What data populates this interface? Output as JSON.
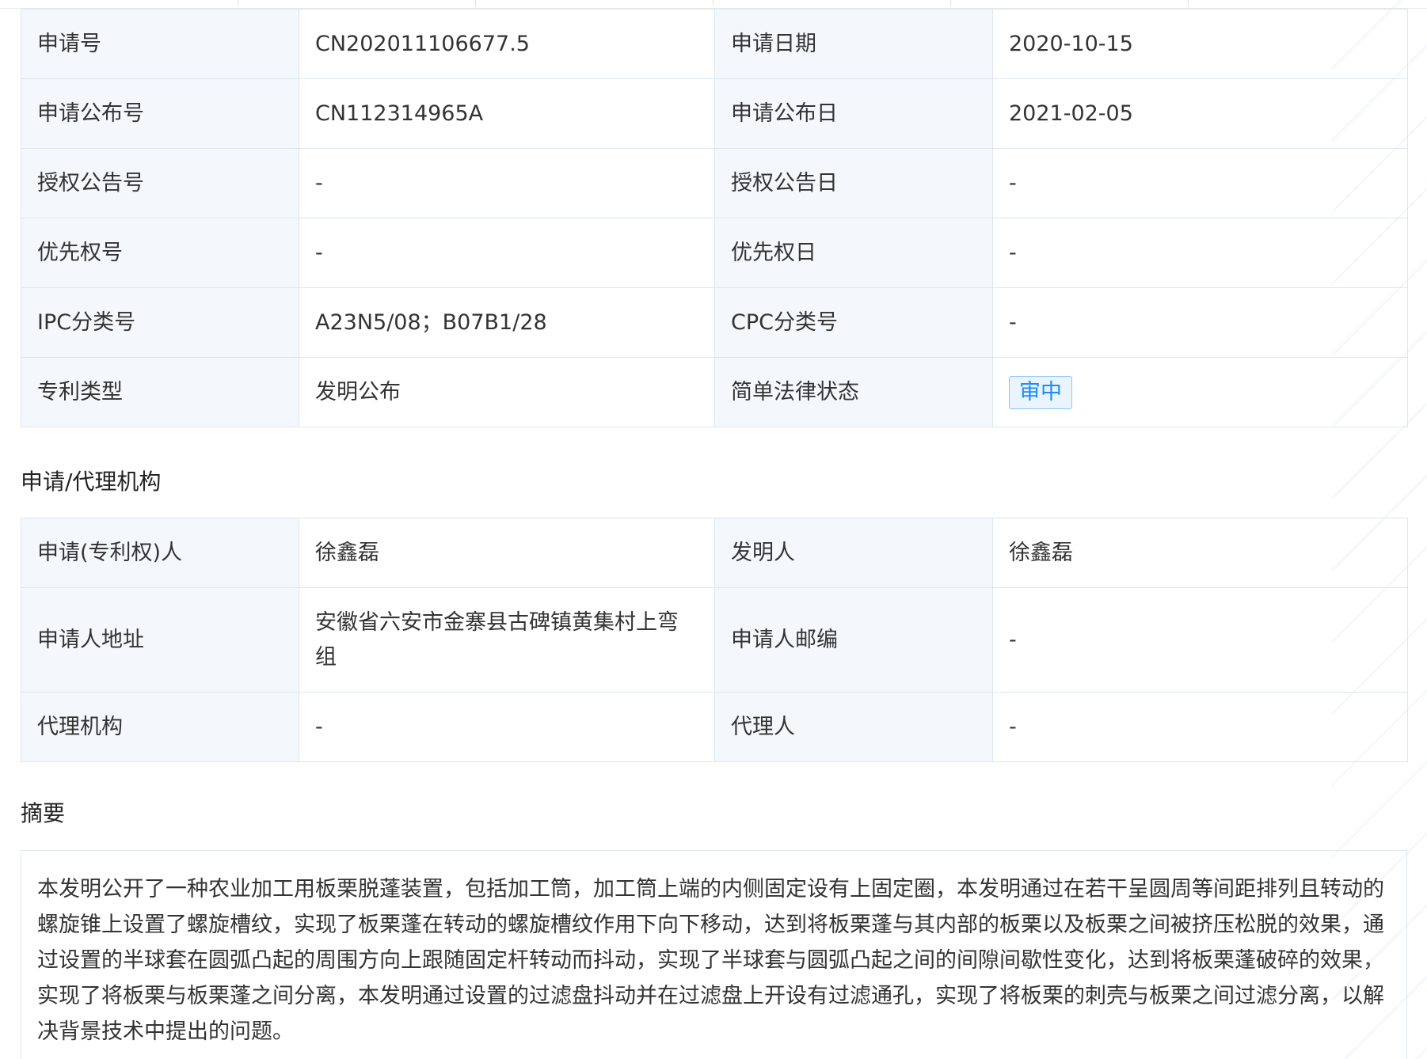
{
  "basic": {
    "rows": [
      {
        "k1": "申请号",
        "v1": "CN202011106677.5",
        "k2": "申请日期",
        "v2": "2020-10-15"
      },
      {
        "k1": "申请公布号",
        "v1": "CN112314965A",
        "k2": "申请公布日",
        "v2": "2021-02-05"
      },
      {
        "k1": "授权公告号",
        "v1": "-",
        "k2": "授权公告日",
        "v2": "-"
      },
      {
        "k1": "优先权号",
        "v1": "-",
        "k2": "优先权日",
        "v2": "-"
      },
      {
        "k1": "IPC分类号",
        "v1": "A23N5/08；B07B1/28",
        "k2": "CPC分类号",
        "v2": "-"
      },
      {
        "k1": "专利类型",
        "v1": "发明公布",
        "k2": "简单法律状态",
        "v2": "审中"
      }
    ]
  },
  "agency": {
    "title": "申请/代理机构",
    "rows": [
      {
        "k1": "申请(专利权)人",
        "v1": "徐鑫磊",
        "k2": "发明人",
        "v2": "徐鑫磊"
      },
      {
        "k1": "申请人地址",
        "v1": "安徽省六安市金寨县古碑镇黄集村上弯组",
        "k2": "申请人邮编",
        "v2": "-"
      },
      {
        "k1": "代理机构",
        "v1": "-",
        "k2": "代理人",
        "v2": "-"
      }
    ]
  },
  "abstract": {
    "title": "摘要",
    "text": "本发明公开了一种农业加工用板栗脱蓬装置，包括加工筒，加工筒上端的内侧固定设有上固定圈，本发明通过在若干呈圆周等间距排列且转动的螺旋锥上设置了螺旋槽纹，实现了板栗蓬在转动的螺旋槽纹作用下向下移动，达到将板栗蓬与其内部的板栗以及板栗之间被挤压松脱的效果，通过设置的半球套在圆弧凸起的周围方向上跟随固定杆转动而抖动，实现了半球套与圆弧凸起之间的间隙间歇性变化，达到将板栗蓬破碎的效果，实现了将板栗与板栗蓬之间分离，本发明通过设置的过滤盘抖动并在过滤盘上开设有过滤通孔，实现了将板栗的刺壳与板栗之间过滤分离，以解决背景技术中提出的问题。"
  },
  "colors": {
    "status_badge": "#1a8cff",
    "key_cell_bg": "#f4f8fc",
    "border": "#dde7f1"
  }
}
